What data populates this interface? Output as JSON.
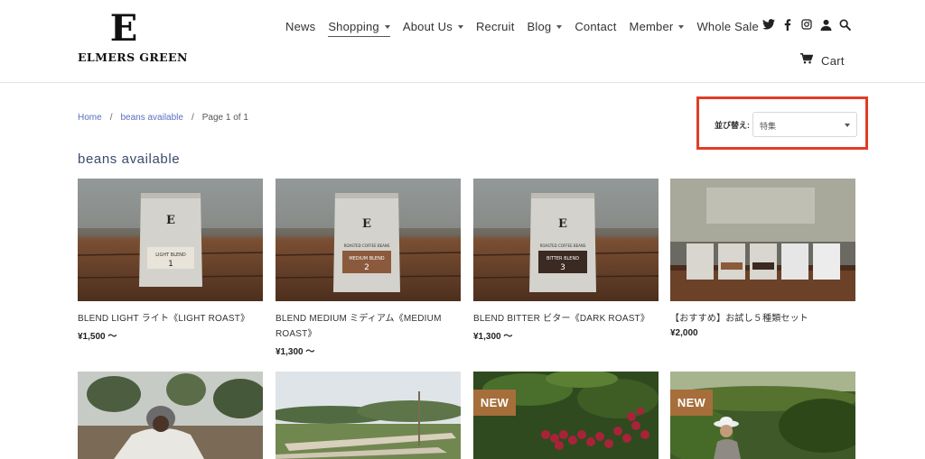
{
  "brand": {
    "mark": "E",
    "name": "ELMERS GREEN"
  },
  "nav": {
    "items": [
      {
        "label": "News",
        "caret": false
      },
      {
        "label": "Shopping",
        "caret": true,
        "active": true
      },
      {
        "label": "About Us",
        "caret": true
      },
      {
        "label": "Recruit",
        "caret": false
      },
      {
        "label": "Blog",
        "caret": true
      },
      {
        "label": "Contact",
        "caret": false
      },
      {
        "label": "Member",
        "caret": true
      },
      {
        "label": "Whole Sale",
        "caret": false
      }
    ],
    "icons": [
      "twitter-icon",
      "facebook-icon",
      "instagram-icon",
      "user-icon",
      "search-icon"
    ],
    "cart_label": "Cart"
  },
  "breadcrumb": {
    "home": "Home",
    "collection": "beans available",
    "page": "Page 1 of 1"
  },
  "sort": {
    "label": "並び替え:",
    "value": "特集"
  },
  "collection_title": "beans available",
  "products": [
    {
      "name": "BLEND LIGHT ライト《LIGHT ROAST》",
      "price": "¥1,500 ～",
      "badge": "",
      "bag_label": "LIGHT BLEND",
      "bag_number": "1"
    },
    {
      "name": "BLEND MEDIUM ミディアム《MEDIUM ROAST》",
      "price": "¥1,300 ～",
      "badge": "",
      "bag_label": "MEDIUM BLEND",
      "bag_number": "2"
    },
    {
      "name": "BLEND BITTER ビター《DARK ROAST》",
      "price": "¥1,300 ～",
      "badge": "",
      "bag_label": "BITTER BLEND",
      "bag_number": "3"
    },
    {
      "name": "【おすすめ】お試し５種類セット",
      "price": "¥2,000",
      "badge": ""
    },
    {
      "name": "",
      "price": "",
      "badge": ""
    },
    {
      "name": "",
      "price": "",
      "badge": ""
    },
    {
      "name": "",
      "price": "",
      "badge": "NEW"
    },
    {
      "name": "",
      "price": "",
      "badge": "NEW"
    }
  ],
  "colors": {
    "accent": "#e23c25",
    "link": "#5b6fc2",
    "badge": "#a66e3a",
    "title": "#3c4a6b"
  }
}
